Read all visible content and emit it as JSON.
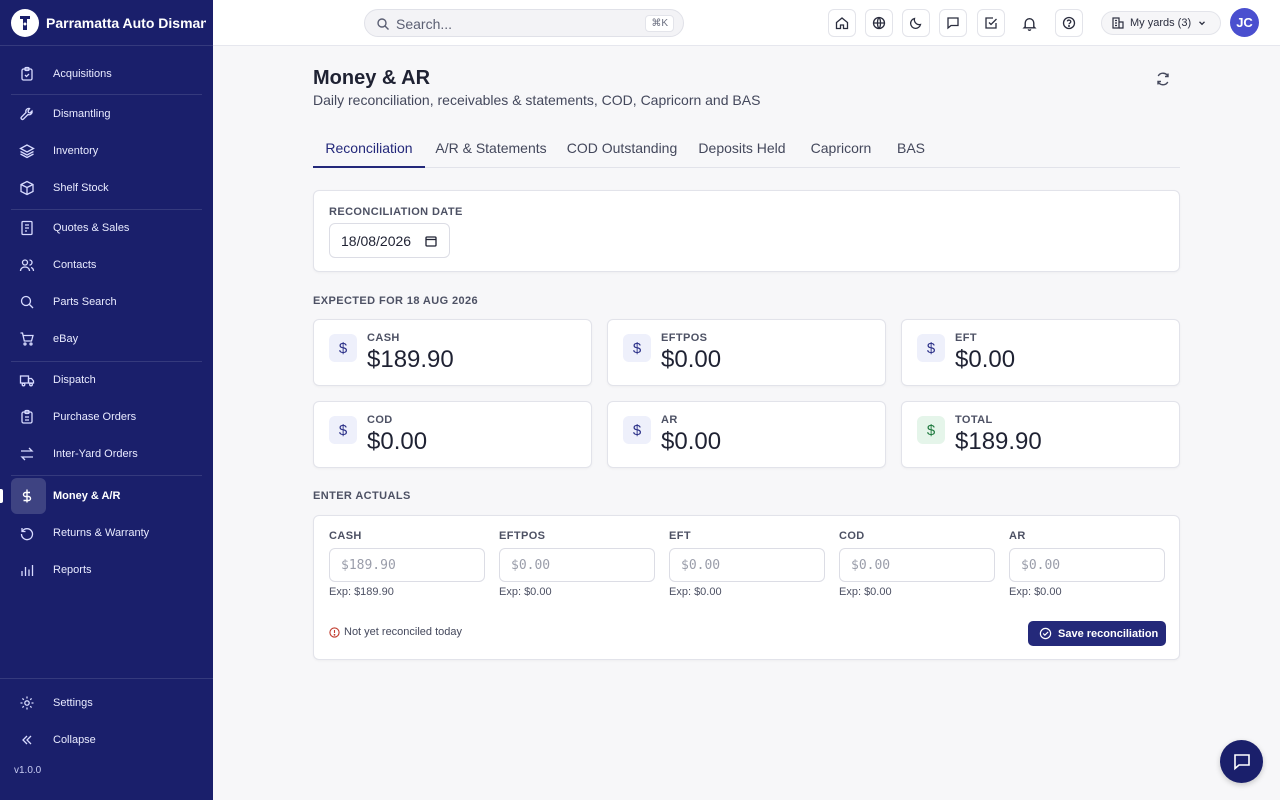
{
  "app": {
    "name": "Parramatta Auto Dismantlers",
    "version": "v1.0.0"
  },
  "sidebar": {
    "items": [
      {
        "label": "Acquisitions",
        "icon": "clipboard-icon"
      },
      {
        "label": "Dismantling",
        "icon": "wrench-icon"
      },
      {
        "label": "Inventory",
        "icon": "layers-icon"
      },
      {
        "label": "Shelf Stock",
        "icon": "box-icon"
      },
      {
        "label": "Quotes & Sales",
        "icon": "receipt-icon"
      },
      {
        "label": "Contacts",
        "icon": "users-icon"
      },
      {
        "label": "Parts Search",
        "icon": "search-icon"
      },
      {
        "label": "eBay",
        "icon": "cart-icon"
      },
      {
        "label": "Dispatch",
        "icon": "truck-icon"
      },
      {
        "label": "Purchase Orders",
        "icon": "clipboard-list-icon"
      },
      {
        "label": "Inter-Yard Orders",
        "icon": "transfer-icon"
      },
      {
        "label": "Money & A/R",
        "icon": "dollar-icon"
      },
      {
        "label": "Returns & Warranty",
        "icon": "return-icon"
      },
      {
        "label": "Reports",
        "icon": "bar-chart-icon"
      }
    ],
    "settings_label": "Settings",
    "collapse_label": "Collapse"
  },
  "topbar": {
    "search_placeholder": "Search...",
    "search_shortcut": "⌘K",
    "yards_label": "My yards (3)",
    "avatar_initials": "JC"
  },
  "page": {
    "title": "Money & AR",
    "subtitle": "Daily reconciliation, receivables & statements, COD, Capricorn and BAS"
  },
  "tabs": [
    {
      "label": "Reconciliation",
      "active": true
    },
    {
      "label": "A/R & Statements",
      "active": false
    },
    {
      "label": "COD Outstanding",
      "active": false
    },
    {
      "label": "Deposits Held",
      "active": false
    },
    {
      "label": "Capricorn",
      "active": false
    },
    {
      "label": "BAS",
      "active": false
    }
  ],
  "reconciliation": {
    "date_label": "RECONCILIATION DATE",
    "date_value": "18/08/2026"
  },
  "expected": {
    "heading": "EXPECTED FOR 18 AUG 2026",
    "stats": [
      {
        "label": "CASH",
        "value": "$189.90"
      },
      {
        "label": "EFTPOS",
        "value": "$0.00"
      },
      {
        "label": "EFT",
        "value": "$0.00"
      },
      {
        "label": "COD",
        "value": "$0.00"
      },
      {
        "label": "AR",
        "value": "$0.00"
      },
      {
        "label": "TOTAL",
        "value": "$189.90"
      }
    ]
  },
  "actuals": {
    "heading": "ENTER ACTUALS",
    "fields": [
      {
        "label": "CASH",
        "placeholder": "$189.90",
        "expected": "Exp: $189.90"
      },
      {
        "label": "EFTPOS",
        "placeholder": "$0.00",
        "expected": "Exp: $0.00"
      },
      {
        "label": "EFT",
        "placeholder": "$0.00",
        "expected": "Exp: $0.00"
      },
      {
        "label": "COD",
        "placeholder": "$0.00",
        "expected": "Exp: $0.00"
      },
      {
        "label": "AR",
        "placeholder": "$0.00",
        "expected": "Exp: $0.00"
      }
    ],
    "status_text": "Not yet reconciled today",
    "save_label": "Save reconciliation"
  },
  "colors": {
    "sidebar_bg": "#1a1f6b",
    "accent": "#24297a",
    "total_icon_bg": "#e5f5ea",
    "status_icon": "#c0392b"
  }
}
